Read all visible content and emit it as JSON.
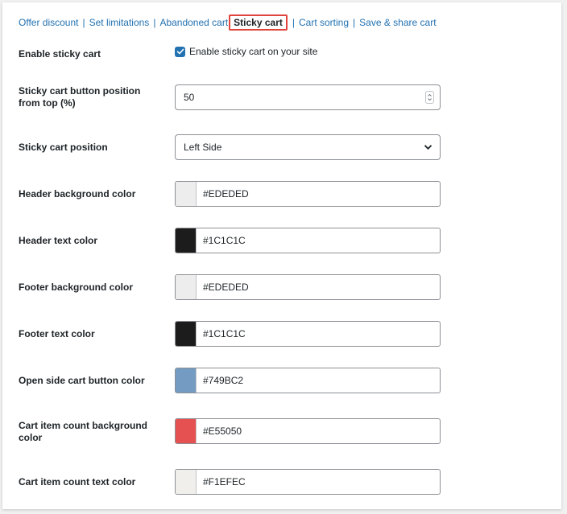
{
  "tabs": [
    {
      "label": "Offer discount"
    },
    {
      "label": "Set limitations"
    },
    {
      "label": "Abandoned cart"
    },
    {
      "label": "Sticky cart",
      "active": true
    },
    {
      "label": "Cart sorting"
    },
    {
      "label": "Save & share cart"
    }
  ],
  "separator": "|",
  "settings": {
    "enable_sticky": {
      "label": "Enable sticky cart",
      "checkbox_label": "Enable sticky cart on your site",
      "checked": true
    },
    "button_position": {
      "label": "Sticky cart button position from top (%)",
      "value": "50"
    },
    "cart_position": {
      "label": "Sticky cart position",
      "value": "Left Side"
    },
    "colors": [
      {
        "label": "Header background color",
        "value": "#EDEDED"
      },
      {
        "label": "Header text color",
        "value": "#1C1C1C"
      },
      {
        "label": "Footer background color",
        "value": "#EDEDED"
      },
      {
        "label": "Footer text color",
        "value": "#1C1C1C"
      },
      {
        "label": "Open side cart button color",
        "value": "#749BC2"
      },
      {
        "label": "Cart item count background color",
        "value": "#E55050"
      },
      {
        "label": "Cart item count text color",
        "value": "#F1EFEC"
      }
    ]
  },
  "accent_color": "#2271B1",
  "highlight_color": "#E0443C"
}
